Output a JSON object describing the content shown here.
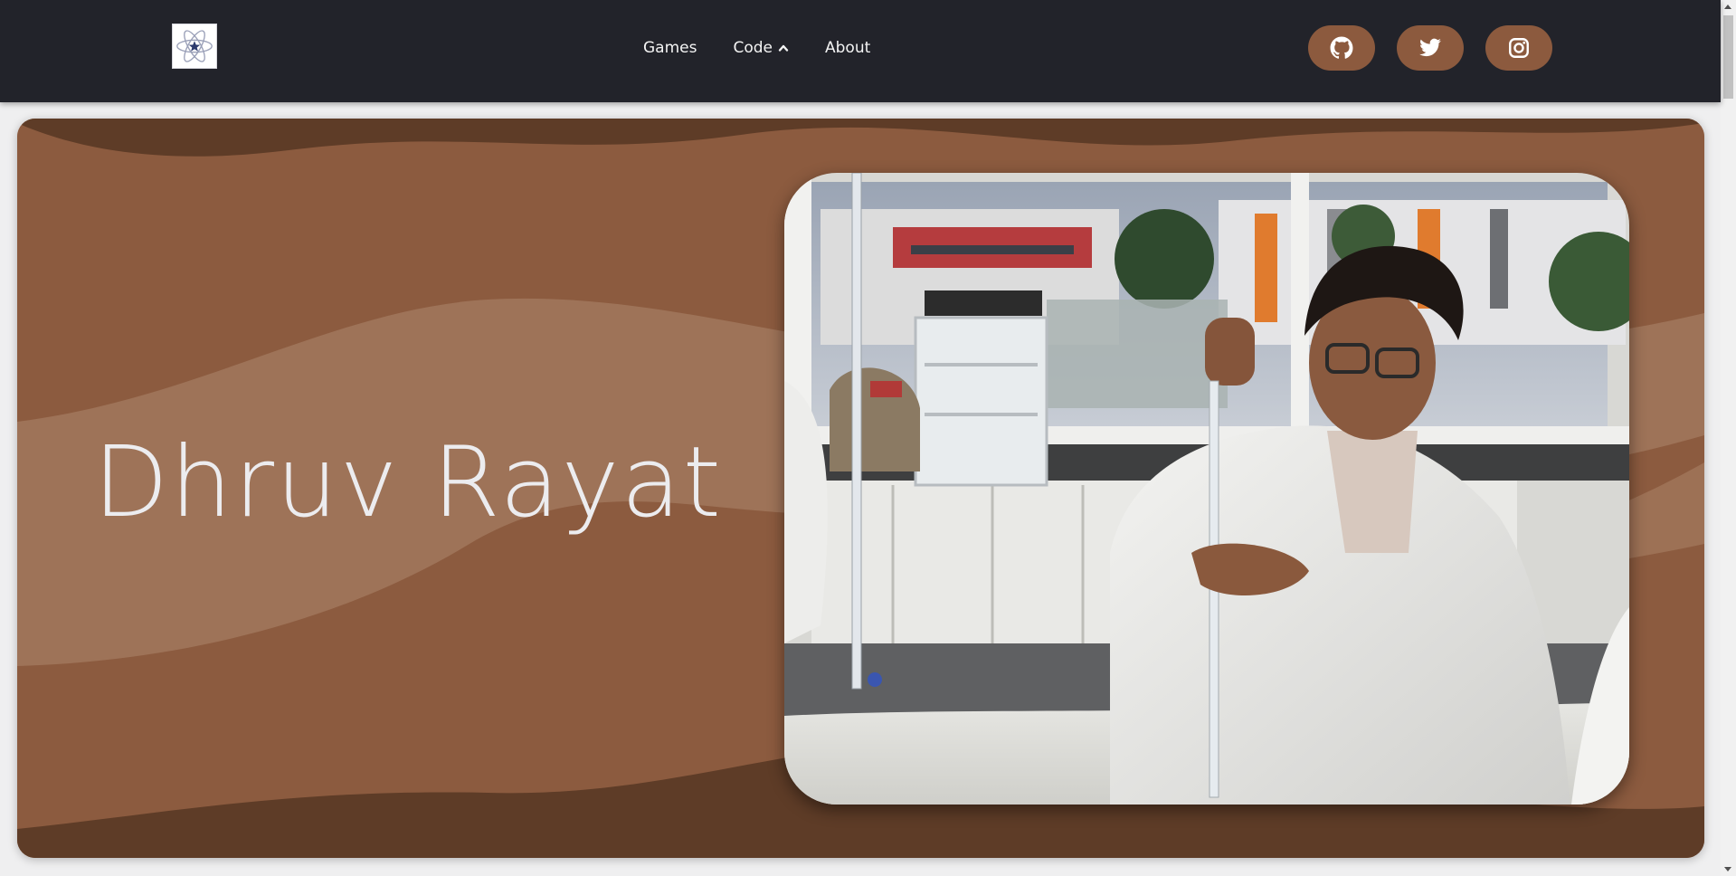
{
  "nav": {
    "items": [
      {
        "label": "Games"
      },
      {
        "label": "Code"
      },
      {
        "label": "About"
      }
    ]
  },
  "social": {
    "items": [
      {
        "icon": "github-icon"
      },
      {
        "icon": "twitter-icon"
      },
      {
        "icon": "instagram-icon"
      }
    ]
  },
  "hero": {
    "title": "Dhruv Rayat"
  },
  "colors": {
    "topbar": "#22232a",
    "accent": "#8c5a3e",
    "hero_dark": "#5e3c27",
    "hero_mid": "#8c5b3f",
    "hero_light": "#9e7358",
    "title_text": "#ececef"
  }
}
